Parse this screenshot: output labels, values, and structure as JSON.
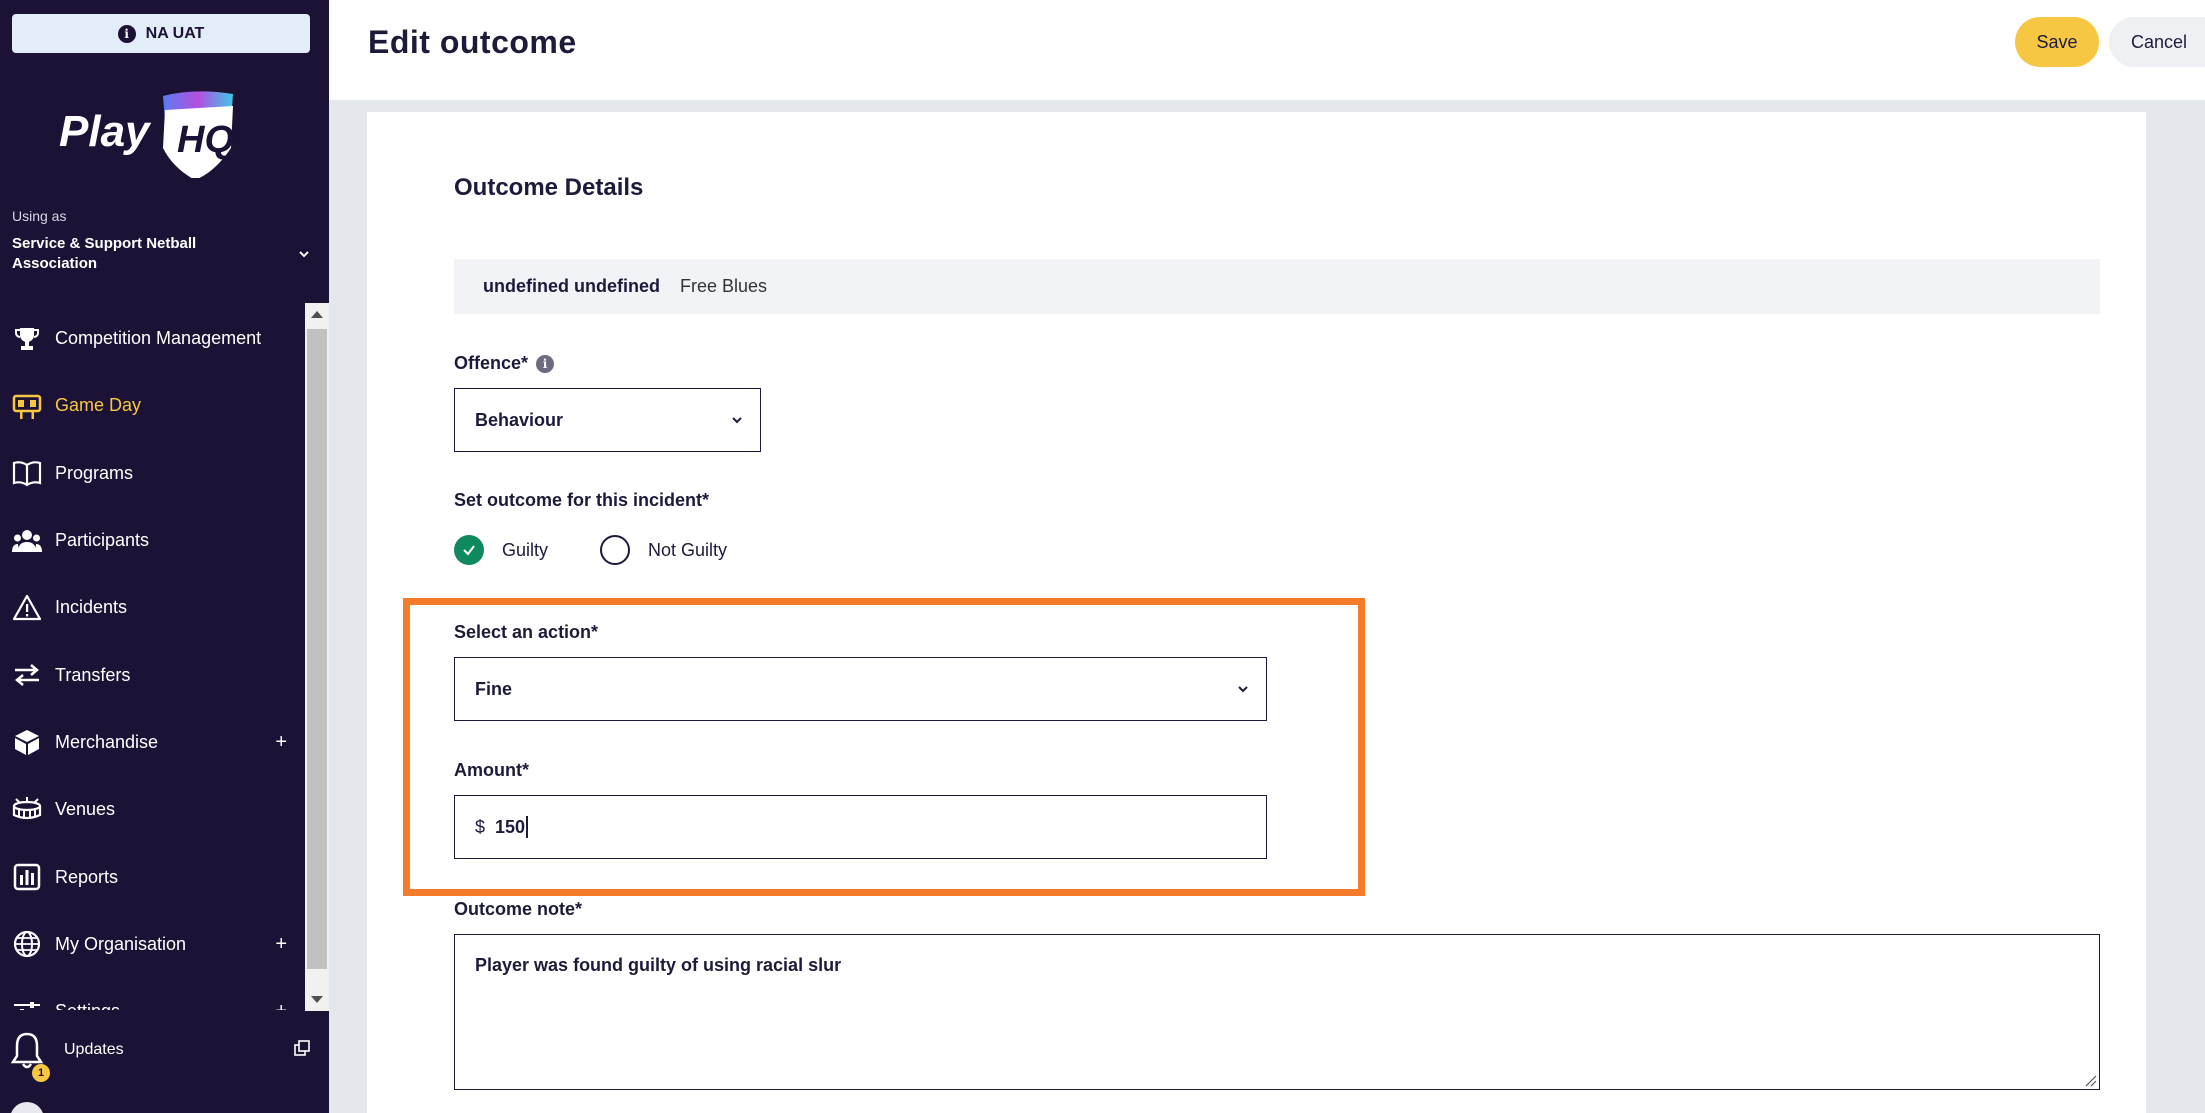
{
  "sidebar": {
    "env_badge": "NA UAT",
    "logo_text": "PlayHQ",
    "using_as_label": "Using as",
    "org_name": "Service & Support Netball Association",
    "nav": [
      {
        "label": "Competition Management",
        "icon": "trophy-icon",
        "active": false,
        "expandable": false
      },
      {
        "label": "Game Day",
        "icon": "scoreboard-icon",
        "active": true,
        "expandable": false
      },
      {
        "label": "Programs",
        "icon": "book-icon",
        "active": false,
        "expandable": false
      },
      {
        "label": "Participants",
        "icon": "people-icon",
        "active": false,
        "expandable": false
      },
      {
        "label": "Incidents",
        "icon": "warning-icon",
        "active": false,
        "expandable": false
      },
      {
        "label": "Transfers",
        "icon": "transfer-arrows-icon",
        "active": false,
        "expandable": false
      },
      {
        "label": "Merchandise",
        "icon": "box-icon",
        "active": false,
        "expandable": true
      },
      {
        "label": "Venues",
        "icon": "stadium-icon",
        "active": false,
        "expandable": false
      },
      {
        "label": "Reports",
        "icon": "bar-chart-icon",
        "active": false,
        "expandable": false
      },
      {
        "label": "My Organisation",
        "icon": "globe-icon",
        "active": false,
        "expandable": true
      },
      {
        "label": "Settings",
        "icon": "sliders-icon",
        "active": false,
        "expandable": true
      }
    ],
    "expand_symbol": "+",
    "updates_label": "Updates",
    "updates_badge": "1"
  },
  "header": {
    "title": "Edit outcome",
    "save_label": "Save",
    "cancel_label": "Cancel"
  },
  "form": {
    "section_title": "Outcome Details",
    "player_name": "undefined undefined",
    "team_name": "Free Blues",
    "offence_label": "Offence*",
    "offence_value": "Behaviour",
    "outcome_label": "Set outcome for this incident*",
    "outcome_options": [
      {
        "label": "Guilty",
        "checked": true
      },
      {
        "label": "Not Guilty",
        "checked": false
      }
    ],
    "action_label": "Select an action*",
    "action_value": "Fine",
    "amount_label": "Amount*",
    "amount_currency": "$",
    "amount_value": "150",
    "note_label": "Outcome note*",
    "note_value": "Player was found guilty of using racial slur"
  },
  "colors": {
    "sidebar_bg": "#1b1235",
    "accent_yellow": "#f7c744",
    "highlight_orange": "#f47b2a",
    "guilty_green": "#0f8a5f"
  }
}
